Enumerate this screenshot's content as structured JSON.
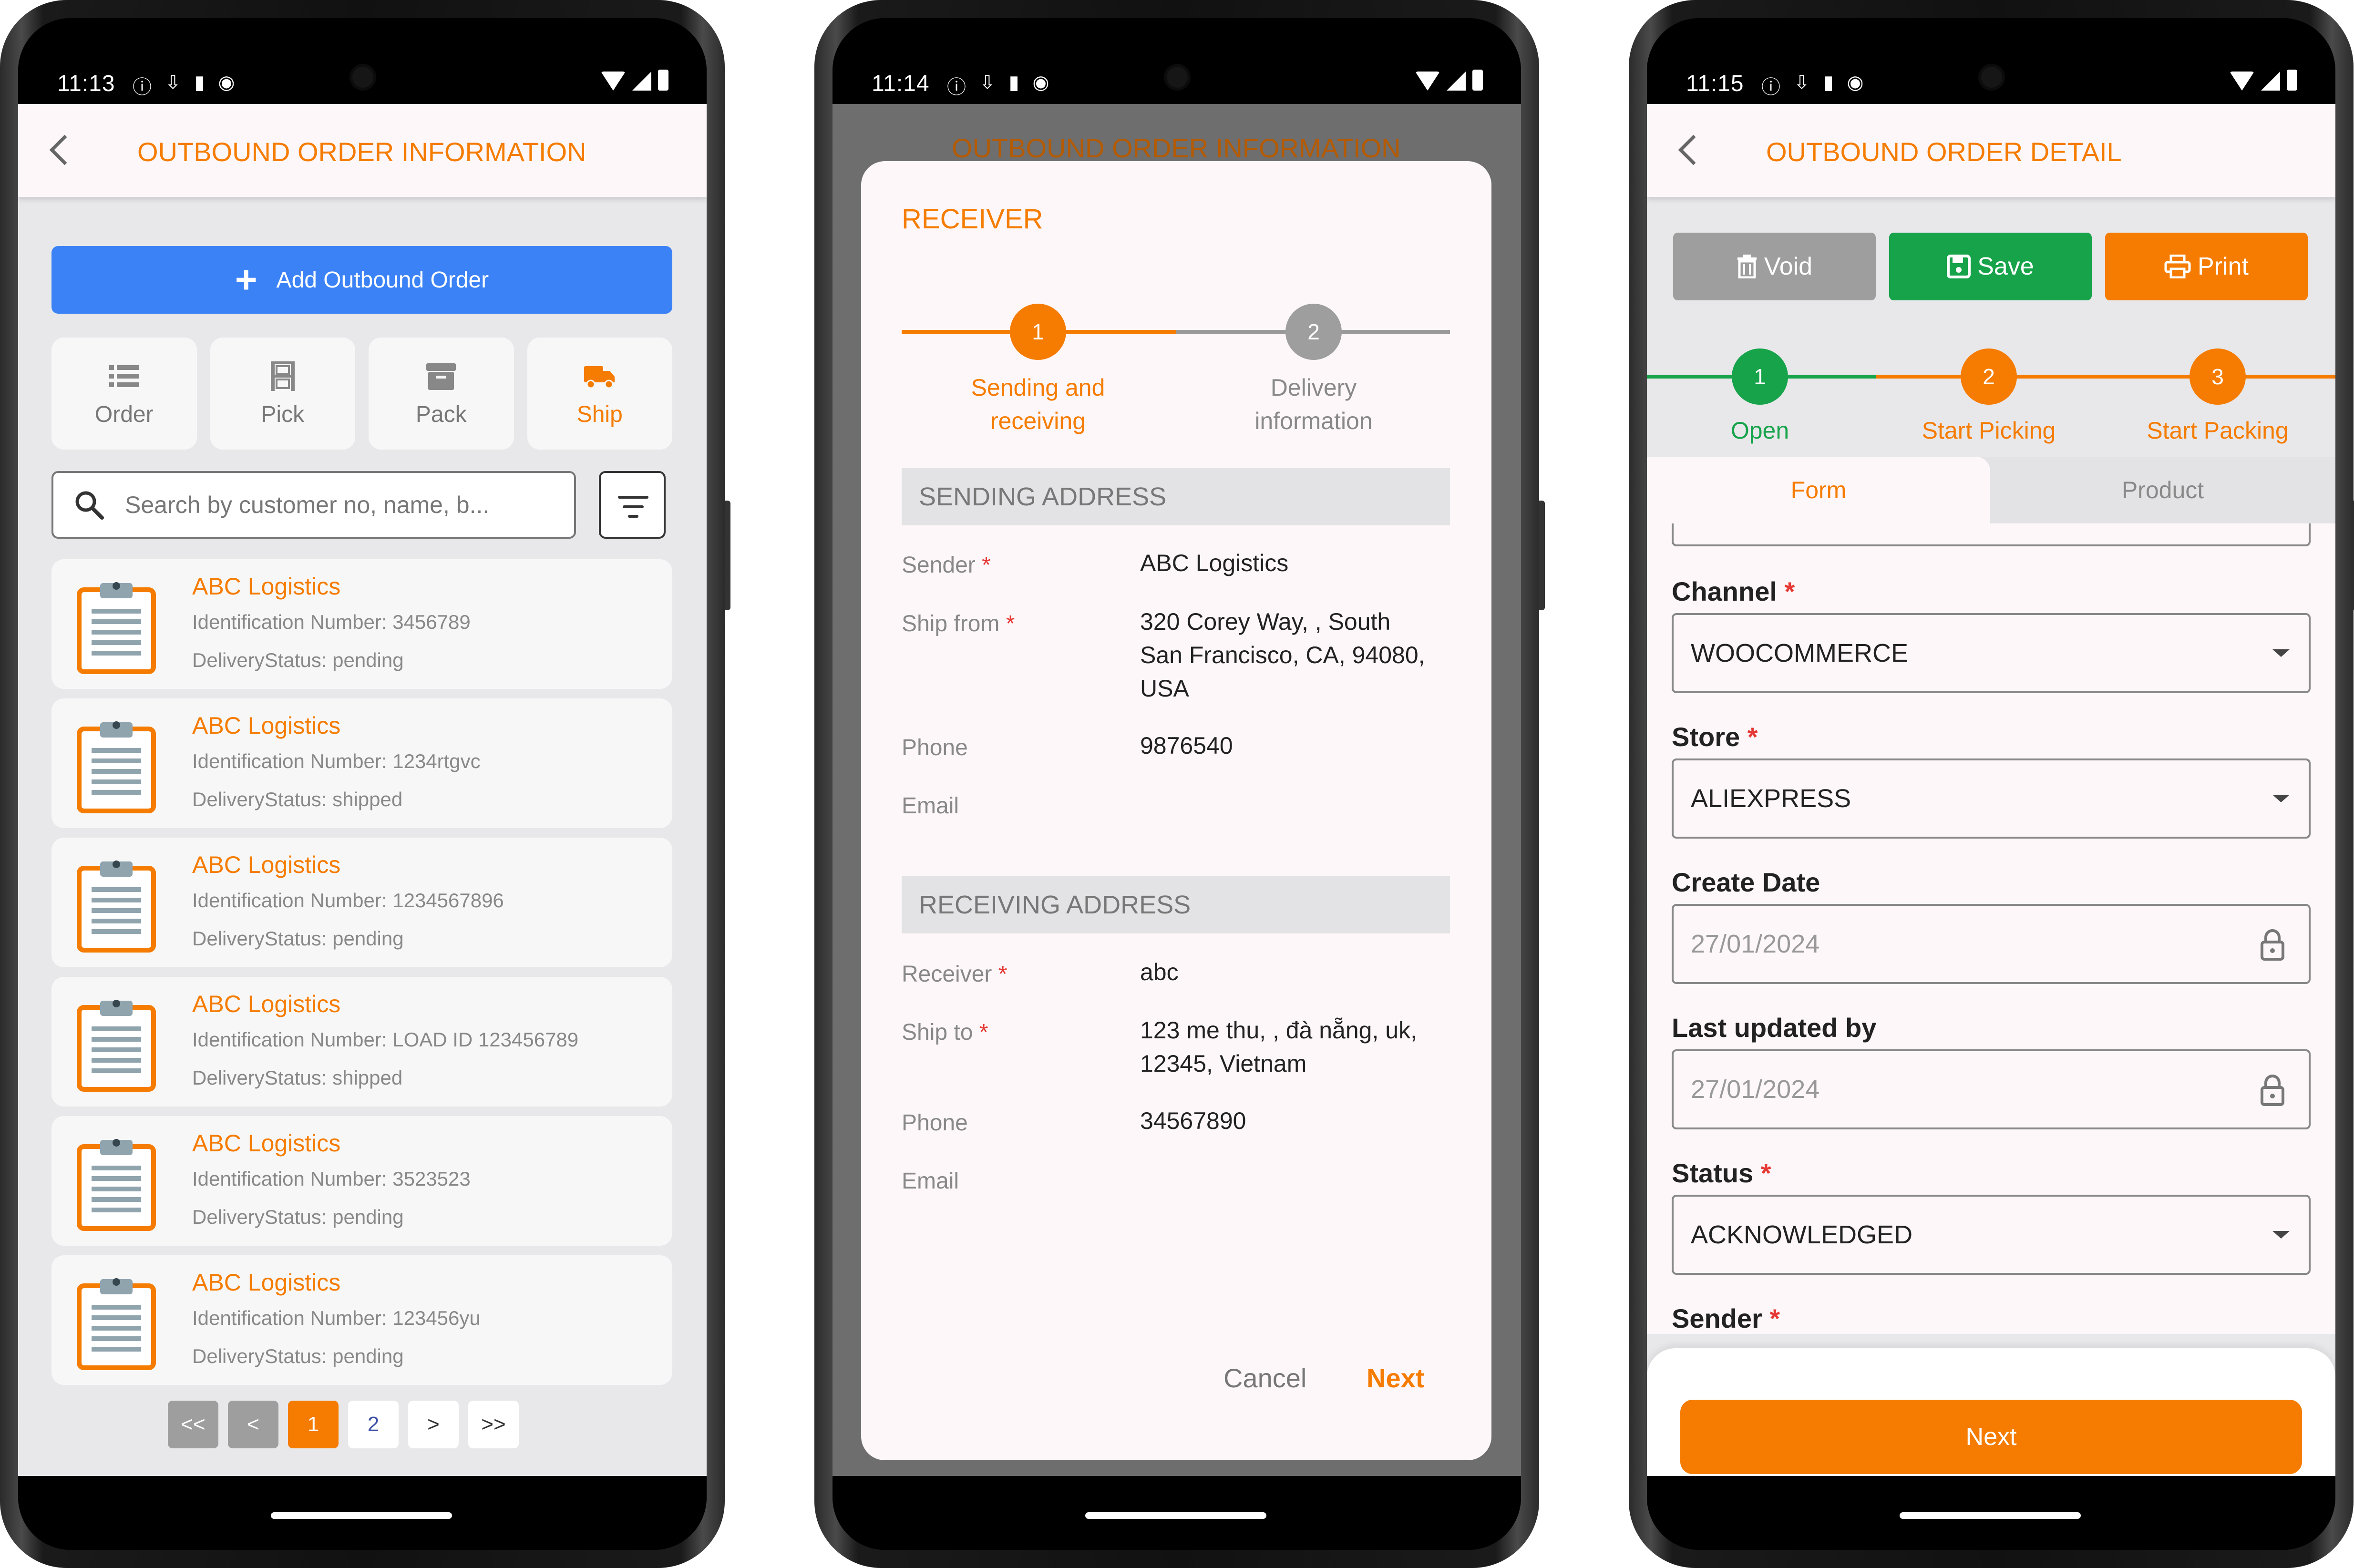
{
  "screens": [
    {
      "status_time": "11:13",
      "title": "OUTBOUND ORDER INFORMATION",
      "add_button": "Add Outbound Order",
      "tabs": [
        {
          "label": "Order",
          "icon": "list-icon",
          "active": false
        },
        {
          "label": "Pick",
          "icon": "pick-icon",
          "active": false
        },
        {
          "label": "Pack",
          "icon": "box-icon",
          "active": false
        },
        {
          "label": "Ship",
          "icon": "truck-icon",
          "active": true
        }
      ],
      "search_placeholder": "Search by customer no, name, b...",
      "orders": [
        {
          "name": "ABC Logistics",
          "id": "Identification Number: 3456789",
          "status": "DeliveryStatus: pending"
        },
        {
          "name": "ABC Logistics",
          "id": "Identification Number: 1234rtgvc",
          "status": "DeliveryStatus: shipped"
        },
        {
          "name": "ABC Logistics",
          "id": "Identification Number: 1234567896",
          "status": "DeliveryStatus: pending"
        },
        {
          "name": "ABC Logistics",
          "id": "Identification Number: LOAD ID 123456789",
          "status": "DeliveryStatus: shipped"
        },
        {
          "name": "ABC Logistics",
          "id": "Identification Number: 3523523",
          "status": "DeliveryStatus: pending"
        },
        {
          "name": "ABC Logistics",
          "id": "Identification Number: 123456yu",
          "status": "DeliveryStatus: pending"
        }
      ],
      "pagination": [
        "<<",
        "<",
        "1",
        "2",
        ">",
        ">>"
      ]
    },
    {
      "status_time": "11:14",
      "background_title": "OUTBOUND ORDER INFORMATION",
      "dialog_title": "RECEIVER",
      "steps": [
        {
          "num": "1",
          "label_l1": "Sending and",
          "label_l2": "receiving"
        },
        {
          "num": "2",
          "label_l1": "Delivery",
          "label_l2": "information"
        }
      ],
      "sending_header": "SENDING ADDRESS",
      "sender_label": "Sender",
      "sender_value": "ABC Logistics",
      "ship_from_label": "Ship from",
      "ship_from_l1": "320 Corey Way, , South",
      "ship_from_l2": "San Francisco, CA, 94080,",
      "ship_from_l3": "USA",
      "phone_label": "Phone",
      "sender_phone": "9876540",
      "email_label": "Email",
      "receiving_header": "RECEIVING ADDRESS",
      "receiver_label": "Receiver",
      "receiver_value": "abc",
      "ship_to_label": "Ship to",
      "ship_to_l1": "123 me thu, , đà nẵng, uk,",
      "ship_to_l2": "12345, Vietnam",
      "receiver_phone": "34567890",
      "cancel": "Cancel",
      "next": "Next"
    },
    {
      "status_time": "11:15",
      "title": "OUTBOUND ORDER DETAIL",
      "void": "Void",
      "save": "Save",
      "print": "Print",
      "steps": [
        {
          "num": "1",
          "label": "Open"
        },
        {
          "num": "2",
          "label": "Start Picking"
        },
        {
          "num": "3",
          "label": "Start Packing"
        }
      ],
      "tab_form": "Form",
      "tab_product": "Product",
      "fields": {
        "channel_label": "Channel",
        "channel_value": "WOOCOMMERCE",
        "store_label": "Store",
        "store_value": "ALIEXPRESS",
        "create_date_label": "Create Date",
        "create_date_value": "27/01/2024",
        "last_updated_label": "Last updated by",
        "last_updated_value": "27/01/2024",
        "status_label": "Status",
        "status_value": "ACKNOWLEDGED",
        "sender_label": "Sender"
      },
      "next": "Next"
    }
  ],
  "colors": {
    "accent": "#f57c00",
    "primary_blue": "#3b82f6",
    "save_green": "#16a34a",
    "void_gray": "#9e9e9e",
    "required_red": "#e53935"
  }
}
